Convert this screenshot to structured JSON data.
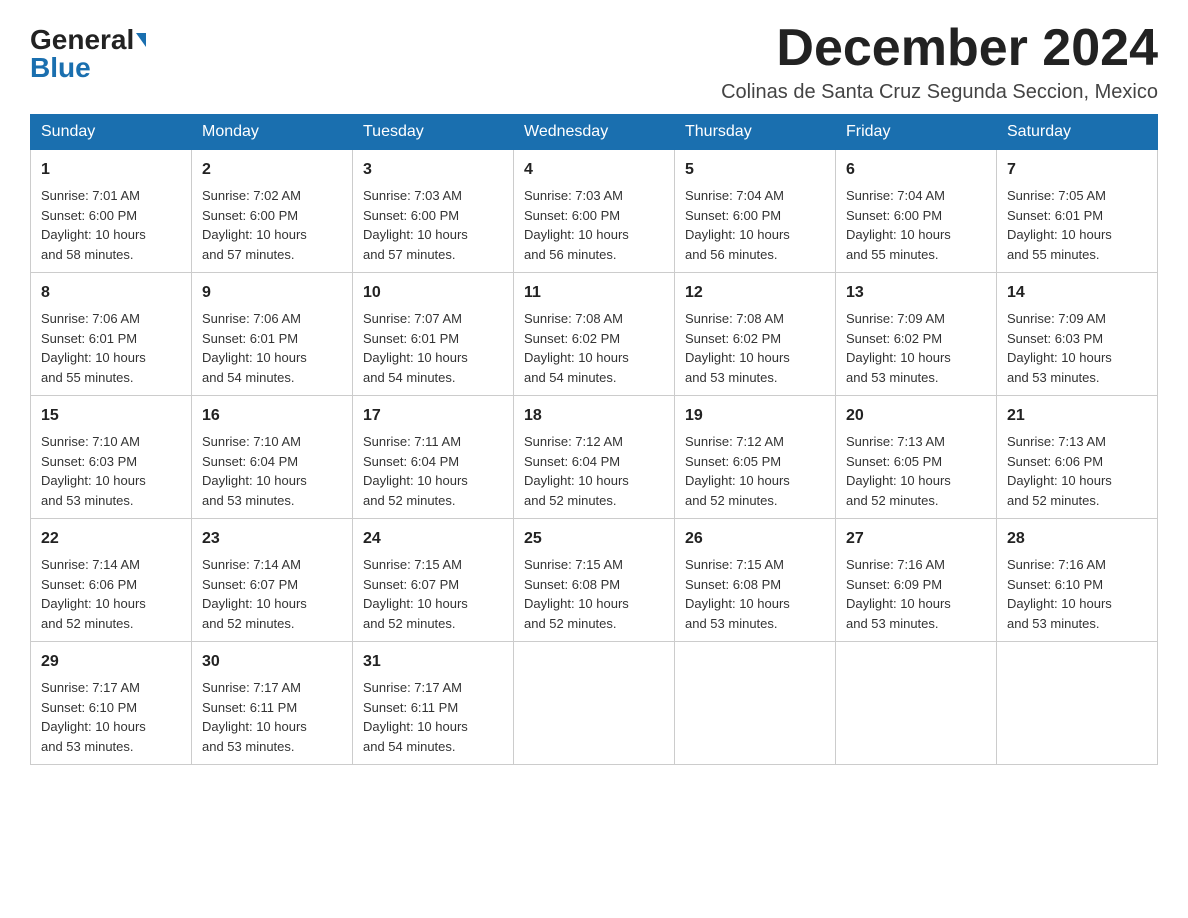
{
  "header": {
    "logo_general": "General",
    "logo_blue": "Blue",
    "month_title": "December 2024",
    "location": "Colinas de Santa Cruz Segunda Seccion, Mexico"
  },
  "weekdays": [
    "Sunday",
    "Monday",
    "Tuesday",
    "Wednesday",
    "Thursday",
    "Friday",
    "Saturday"
  ],
  "weeks": [
    [
      {
        "day": "1",
        "sunrise": "7:01 AM",
        "sunset": "6:00 PM",
        "daylight": "10 hours and 58 minutes."
      },
      {
        "day": "2",
        "sunrise": "7:02 AM",
        "sunset": "6:00 PM",
        "daylight": "10 hours and 57 minutes."
      },
      {
        "day": "3",
        "sunrise": "7:03 AM",
        "sunset": "6:00 PM",
        "daylight": "10 hours and 57 minutes."
      },
      {
        "day": "4",
        "sunrise": "7:03 AM",
        "sunset": "6:00 PM",
        "daylight": "10 hours and 56 minutes."
      },
      {
        "day": "5",
        "sunrise": "7:04 AM",
        "sunset": "6:00 PM",
        "daylight": "10 hours and 56 minutes."
      },
      {
        "day": "6",
        "sunrise": "7:04 AM",
        "sunset": "6:00 PM",
        "daylight": "10 hours and 55 minutes."
      },
      {
        "day": "7",
        "sunrise": "7:05 AM",
        "sunset": "6:01 PM",
        "daylight": "10 hours and 55 minutes."
      }
    ],
    [
      {
        "day": "8",
        "sunrise": "7:06 AM",
        "sunset": "6:01 PM",
        "daylight": "10 hours and 55 minutes."
      },
      {
        "day": "9",
        "sunrise": "7:06 AM",
        "sunset": "6:01 PM",
        "daylight": "10 hours and 54 minutes."
      },
      {
        "day": "10",
        "sunrise": "7:07 AM",
        "sunset": "6:01 PM",
        "daylight": "10 hours and 54 minutes."
      },
      {
        "day": "11",
        "sunrise": "7:08 AM",
        "sunset": "6:02 PM",
        "daylight": "10 hours and 54 minutes."
      },
      {
        "day": "12",
        "sunrise": "7:08 AM",
        "sunset": "6:02 PM",
        "daylight": "10 hours and 53 minutes."
      },
      {
        "day": "13",
        "sunrise": "7:09 AM",
        "sunset": "6:02 PM",
        "daylight": "10 hours and 53 minutes."
      },
      {
        "day": "14",
        "sunrise": "7:09 AM",
        "sunset": "6:03 PM",
        "daylight": "10 hours and 53 minutes."
      }
    ],
    [
      {
        "day": "15",
        "sunrise": "7:10 AM",
        "sunset": "6:03 PM",
        "daylight": "10 hours and 53 minutes."
      },
      {
        "day": "16",
        "sunrise": "7:10 AM",
        "sunset": "6:04 PM",
        "daylight": "10 hours and 53 minutes."
      },
      {
        "day": "17",
        "sunrise": "7:11 AM",
        "sunset": "6:04 PM",
        "daylight": "10 hours and 52 minutes."
      },
      {
        "day": "18",
        "sunrise": "7:12 AM",
        "sunset": "6:04 PM",
        "daylight": "10 hours and 52 minutes."
      },
      {
        "day": "19",
        "sunrise": "7:12 AM",
        "sunset": "6:05 PM",
        "daylight": "10 hours and 52 minutes."
      },
      {
        "day": "20",
        "sunrise": "7:13 AM",
        "sunset": "6:05 PM",
        "daylight": "10 hours and 52 minutes."
      },
      {
        "day": "21",
        "sunrise": "7:13 AM",
        "sunset": "6:06 PM",
        "daylight": "10 hours and 52 minutes."
      }
    ],
    [
      {
        "day": "22",
        "sunrise": "7:14 AM",
        "sunset": "6:06 PM",
        "daylight": "10 hours and 52 minutes."
      },
      {
        "day": "23",
        "sunrise": "7:14 AM",
        "sunset": "6:07 PM",
        "daylight": "10 hours and 52 minutes."
      },
      {
        "day": "24",
        "sunrise": "7:15 AM",
        "sunset": "6:07 PM",
        "daylight": "10 hours and 52 minutes."
      },
      {
        "day": "25",
        "sunrise": "7:15 AM",
        "sunset": "6:08 PM",
        "daylight": "10 hours and 52 minutes."
      },
      {
        "day": "26",
        "sunrise": "7:15 AM",
        "sunset": "6:08 PM",
        "daylight": "10 hours and 53 minutes."
      },
      {
        "day": "27",
        "sunrise": "7:16 AM",
        "sunset": "6:09 PM",
        "daylight": "10 hours and 53 minutes."
      },
      {
        "day": "28",
        "sunrise": "7:16 AM",
        "sunset": "6:10 PM",
        "daylight": "10 hours and 53 minutes."
      }
    ],
    [
      {
        "day": "29",
        "sunrise": "7:17 AM",
        "sunset": "6:10 PM",
        "daylight": "10 hours and 53 minutes."
      },
      {
        "day": "30",
        "sunrise": "7:17 AM",
        "sunset": "6:11 PM",
        "daylight": "10 hours and 53 minutes."
      },
      {
        "day": "31",
        "sunrise": "7:17 AM",
        "sunset": "6:11 PM",
        "daylight": "10 hours and 54 minutes."
      },
      null,
      null,
      null,
      null
    ]
  ],
  "labels": {
    "sunrise": "Sunrise:",
    "sunset": "Sunset:",
    "daylight": "Daylight:"
  }
}
